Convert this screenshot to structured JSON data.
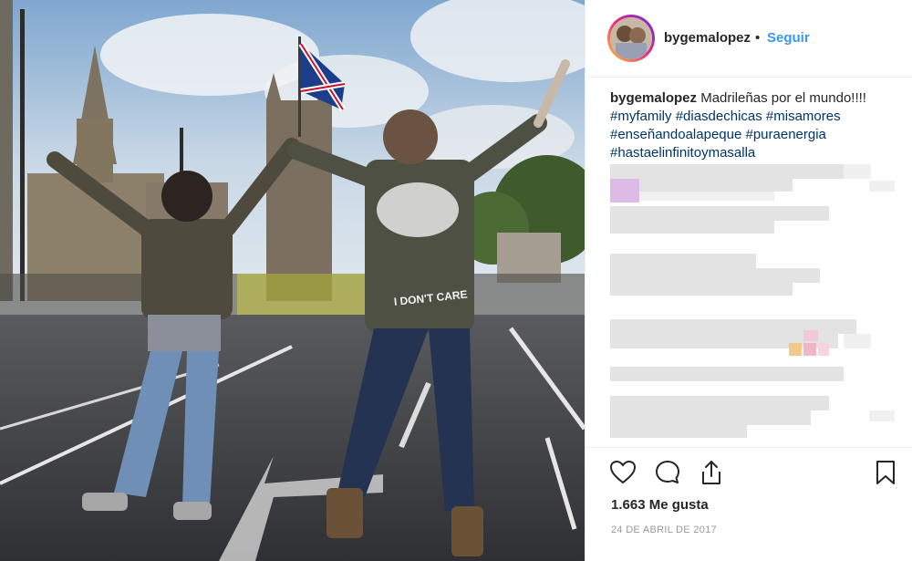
{
  "post": {
    "username": "bygemalopez",
    "separator": "•",
    "follow_label": "Seguir",
    "caption_text": "Madrileñas por el mundo!!!!",
    "hashtags": [
      "#myfamily",
      "#diasdechicas",
      "#misamores",
      "#enseñandoalapeque",
      "#puraenergia",
      "#hastaelinfinitoymasalla"
    ],
    "likes_text": "1.663 Me gusta",
    "date_text": "24 DE ABRIL DE 2017",
    "photo_jacket_text": "I DON'T CARE"
  },
  "icons": {
    "like": "heart-icon",
    "comment": "comment-icon",
    "share": "share-icon",
    "save": "bookmark-icon"
  },
  "colors": {
    "link_blue": "#3897f0",
    "hashtag": "#003569",
    "text": "#262626",
    "muted": "#999999"
  }
}
